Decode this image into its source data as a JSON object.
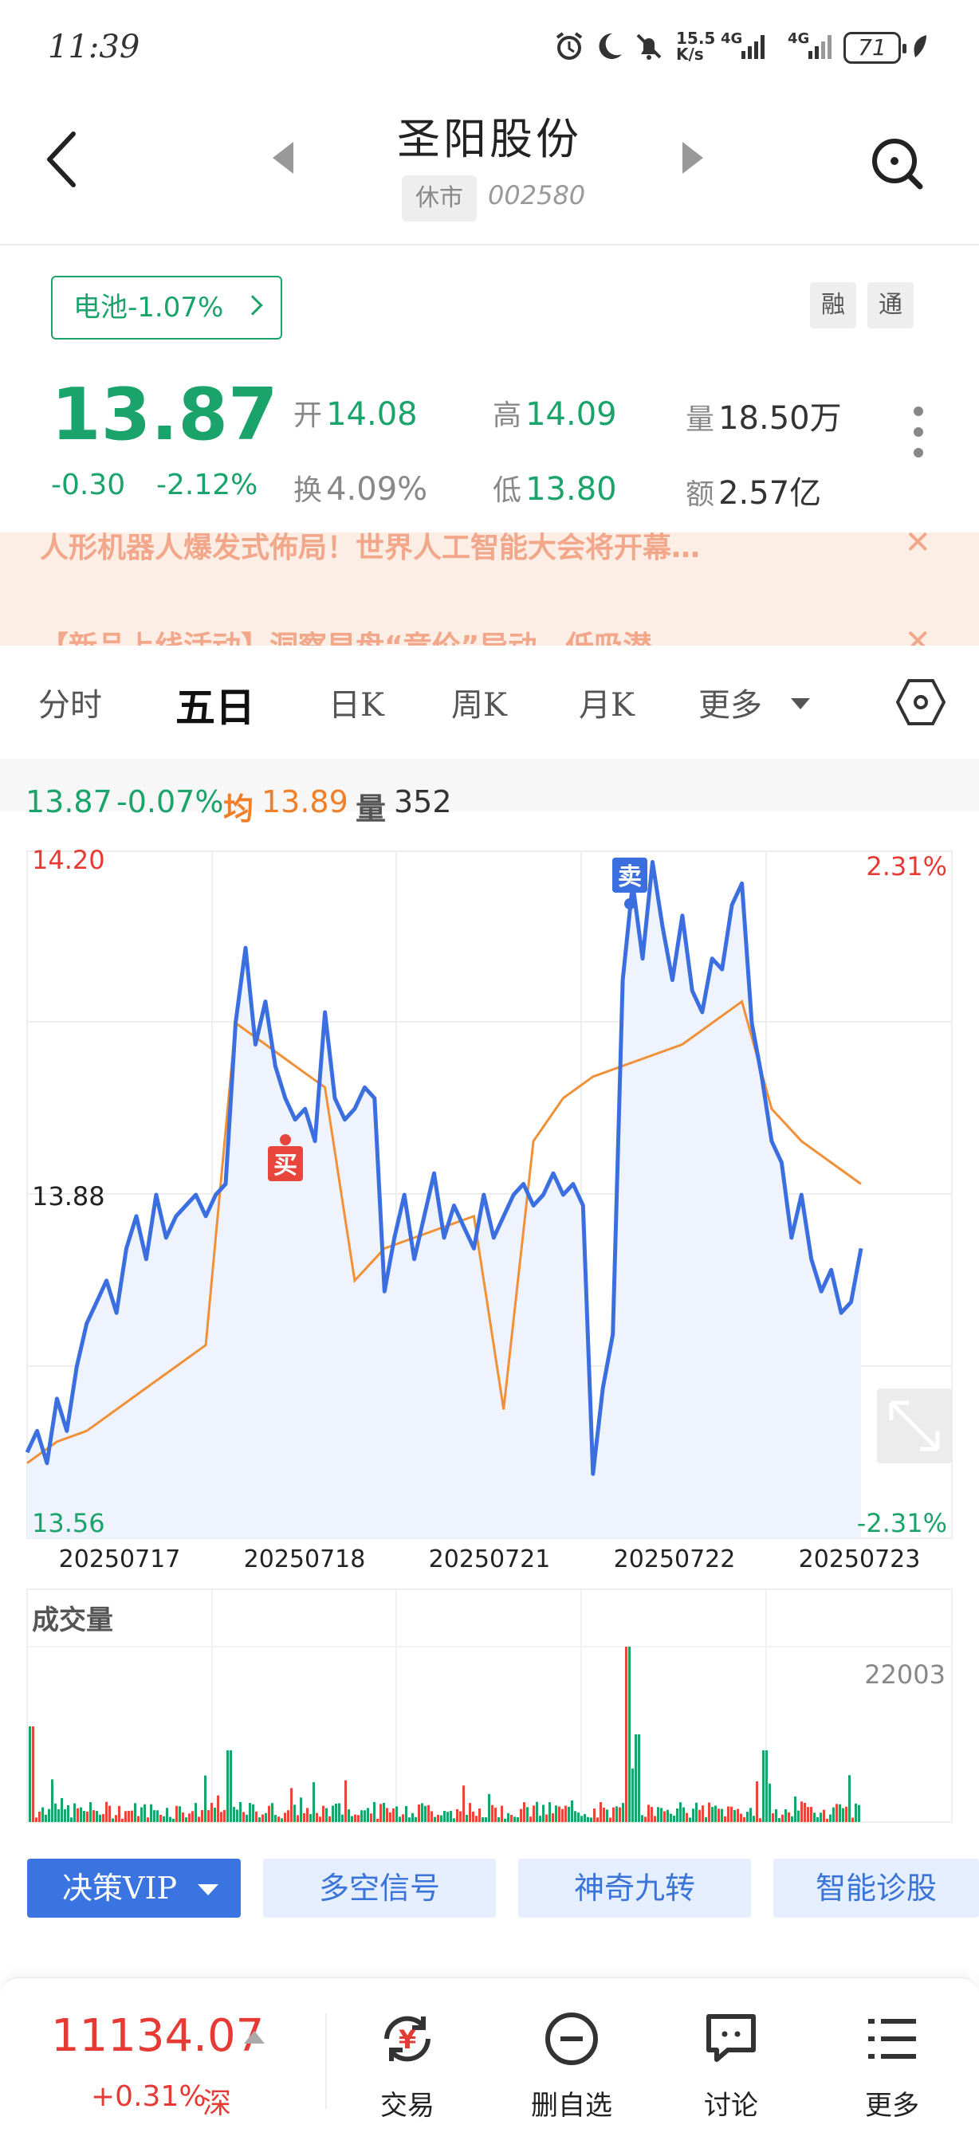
{
  "status_bar": {
    "time": "11:39",
    "net_speed_top": "15.5",
    "net_speed_unit": "K/s",
    "net_sim1": "4G",
    "net_sim2": "4G",
    "battery": "71"
  },
  "header": {
    "name": "圣阳股份",
    "market_status": "休市",
    "code": "002580"
  },
  "sector": {
    "label": "电池-1.07%"
  },
  "badges": {
    "margin": "融",
    "connect": "通"
  },
  "quote": {
    "price": "13.87",
    "change": "-0.30",
    "change_pct": "-2.12%",
    "open_label": "开",
    "open": "14.08",
    "high_label": "高",
    "high": "14.09",
    "volume_label": "量",
    "volume": "18.50万",
    "turnover_label": "换",
    "turnover": "4.09%",
    "low_label": "低",
    "low": "13.80",
    "amount_label": "额",
    "amount": "2.57亿"
  },
  "news": [
    {
      "text": "人形机器人爆发式佈局！世界人工智能大会将开幕…"
    },
    {
      "text": "【新品上线活动】洞察早盘“竞价”异动，低吸潜…"
    }
  ],
  "tabs": {
    "intraday": "分时",
    "five_day": "五日",
    "day_k": "日K",
    "week_k": "周K",
    "month_k": "月K",
    "more": "更多"
  },
  "info_bar": {
    "price": "13.87",
    "pct": "-0.07%",
    "avg_label": "均",
    "avg": "13.89",
    "vol_label": "量",
    "vol": "352"
  },
  "chart_data": {
    "type": "line",
    "dates": [
      "20250717",
      "20250718",
      "20250721",
      "20250722",
      "20250723"
    ],
    "y_top": "14.20",
    "y_mid": "13.88",
    "y_bottom": "13.56",
    "pct_top": "2.31%",
    "pct_bottom": "-2.31%",
    "ylim": [
      13.56,
      14.2
    ],
    "series": [
      {
        "name": "价格",
        "color": "#3b6fe0",
        "values": [
          13.64,
          13.66,
          13.63,
          13.69,
          13.66,
          13.72,
          13.76,
          13.78,
          13.8,
          13.77,
          13.83,
          13.86,
          13.82,
          13.88,
          13.84,
          13.86,
          13.87,
          13.88,
          13.86,
          13.88,
          13.89,
          14.04,
          14.11,
          14.02,
          14.06,
          14.0,
          13.97,
          13.95,
          13.96,
          13.93,
          14.05,
          13.97,
          13.95,
          13.96,
          13.98,
          13.97,
          13.79,
          13.84,
          13.88,
          13.82,
          13.86,
          13.9,
          13.84,
          13.87,
          13.85,
          13.83,
          13.88,
          13.84,
          13.86,
          13.88,
          13.89,
          13.87,
          13.88,
          13.9,
          13.88,
          13.89,
          13.87,
          13.62,
          13.7,
          13.75,
          14.08,
          14.17,
          14.1,
          14.19,
          14.13,
          14.08,
          14.14,
          14.07,
          14.05,
          14.1,
          14.09,
          14.15,
          14.17,
          14.04,
          13.99,
          13.93,
          13.91,
          13.84,
          13.88,
          13.82,
          13.79,
          13.81,
          13.77,
          13.78,
          13.83
        ],
        "annotations": [
          {
            "label": "买",
            "date_index": 1
          },
          {
            "label": "卖",
            "date_index": 3
          }
        ]
      },
      {
        "name": "均价",
        "color": "#f0913a",
        "values": [
          13.63,
          13.65,
          13.66,
          13.68,
          13.7,
          13.72,
          13.74,
          14.04,
          14.02,
          14.0,
          13.98,
          13.8,
          13.83,
          13.84,
          13.85,
          13.86,
          13.68,
          13.93,
          13.97,
          13.99,
          14.0,
          14.01,
          14.02,
          14.04,
          14.06,
          13.96,
          13.93,
          13.91,
          13.89
        ]
      }
    ],
    "volume": {
      "title": "成交量",
      "max_label": "22003"
    }
  },
  "features": {
    "vip": "决策VIP",
    "signal": "多空信号",
    "nine": "神奇九转",
    "diagnose": "智能诊股"
  },
  "bottom": {
    "index_value": "11134.07",
    "index_change": "+0.31%",
    "index_market": "深",
    "trade": "交易",
    "remove_watch": "删自选",
    "discuss": "讨论",
    "more": "更多"
  },
  "colors": {
    "up": "#e63a35",
    "down": "#1aa36a",
    "price_line": "#3b6fe0",
    "avg_line": "#f0913a",
    "accent": "#3a74e0"
  }
}
